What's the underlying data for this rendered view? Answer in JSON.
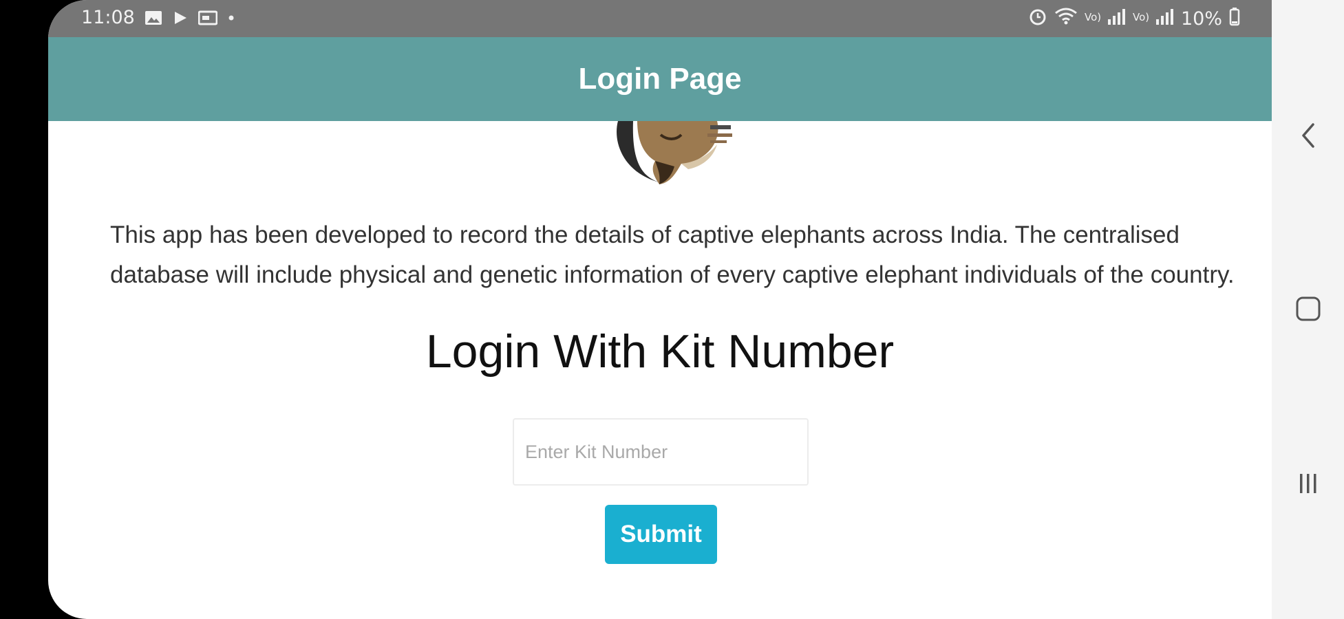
{
  "status_bar": {
    "time": "11:08",
    "battery": "10%",
    "left_icons": [
      "image-notification-icon",
      "play-notification-icon",
      "screen-notification-icon",
      "dot-icon"
    ],
    "right_icons": [
      "alarm-icon",
      "wifi-icon",
      "signal-icon",
      "signal-icon",
      "battery-icon"
    ]
  },
  "app_bar": {
    "title": "Login Page",
    "color": "#5f9f9f"
  },
  "description": "This app has been developed to record the details of captive elephants across India. The centralised database will include physical and genetic information of every captive elephant individuals of the country.",
  "login": {
    "heading": "Login With Kit Number",
    "kit_input": {
      "placeholder": "Enter Kit Number",
      "value": ""
    },
    "submit_label": "Submit",
    "submit_color": "#1aafd0"
  },
  "nav_bar": {
    "buttons": [
      "back-icon",
      "home-icon",
      "recent-apps-icon"
    ]
  }
}
